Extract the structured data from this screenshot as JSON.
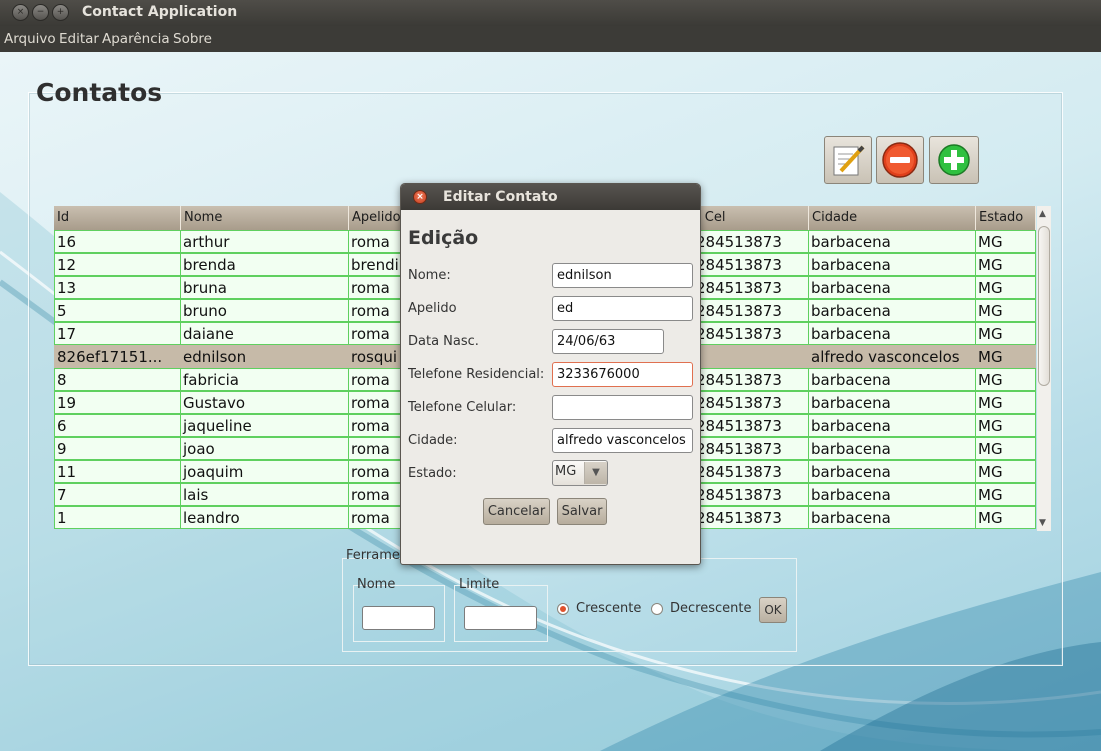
{
  "window": {
    "title": "Contact Application",
    "controls": [
      "×",
      "−",
      "+"
    ]
  },
  "menu": [
    "Arquivo",
    "Editar",
    "Aparência",
    "Sobre"
  ],
  "main": {
    "title": "Contatos",
    "toolbar_icons": [
      "edit-icon",
      "remove-icon",
      "add-icon"
    ]
  },
  "table": {
    "columns": [
      "Id",
      "Nome",
      "Apelido",
      "",
      "",
      "l Cel",
      "Cidade",
      "Estado"
    ],
    "rows": [
      [
        "16",
        "arthur",
        "roma",
        "",
        "",
        "284513873",
        "barbacena",
        "MG"
      ],
      [
        "12",
        "brenda",
        "brendi",
        "",
        "",
        "284513873",
        "barbacena",
        "MG"
      ],
      [
        "13",
        "bruna",
        "roma",
        "",
        "",
        "284513873",
        "barbacena",
        "MG"
      ],
      [
        "5",
        "bruno",
        "roma",
        "",
        "",
        "284513873",
        "barbacena",
        "MG"
      ],
      [
        "17",
        "daiane",
        "roma",
        "",
        "",
        "284513873",
        "barbacena",
        "MG"
      ],
      [
        "826ef17151...",
        "ednilson",
        "rosqui",
        "",
        "",
        "",
        "alfredo vasconcelos",
        "MG"
      ],
      [
        "8",
        "fabricia",
        "roma",
        "",
        "",
        "284513873",
        "barbacena",
        "MG"
      ],
      [
        "19",
        "Gustavo",
        "roma",
        "",
        "",
        "284513873",
        "barbacena",
        "MG"
      ],
      [
        "6",
        "jaqueline",
        "roma",
        "",
        "",
        "284513873",
        "barbacena",
        "MG"
      ],
      [
        "9",
        "joao",
        "roma",
        "",
        "",
        "284513873",
        "barbacena",
        "MG"
      ],
      [
        "11",
        "joaquim",
        "roma",
        "",
        "",
        "284513873",
        "barbacena",
        "MG"
      ],
      [
        "7",
        "lais",
        "roma",
        "",
        "",
        "284513873",
        "barbacena",
        "MG"
      ],
      [
        "1",
        "leandro",
        "roma",
        "",
        "",
        "284513873",
        "barbacena",
        "MG"
      ]
    ],
    "selected_row": 5
  },
  "tools": {
    "title": "Ferrame",
    "nome_label": "Nome",
    "limite_label": "Limite",
    "crescente_label": "Crescente",
    "decrescente_label": "Decrescente",
    "ok_label": "OK"
  },
  "dialog": {
    "title": "Editar Contato",
    "heading": "Edição",
    "fields": [
      {
        "label": "Nome:",
        "value": "ednilson"
      },
      {
        "label": "Apelido",
        "value": "ed"
      },
      {
        "label": "Data Nasc.",
        "value": "24/06/63"
      },
      {
        "label": "Telefone Residencial:",
        "value": "3233676000"
      },
      {
        "label": "Telefone Celular:",
        "value": ""
      },
      {
        "label": "Cidade:",
        "value": "alfredo vasconcelos"
      }
    ],
    "estado_label": "Estado:",
    "estado_value": "MG",
    "cancel_label": "Cancelar",
    "save_label": "Salvar"
  }
}
